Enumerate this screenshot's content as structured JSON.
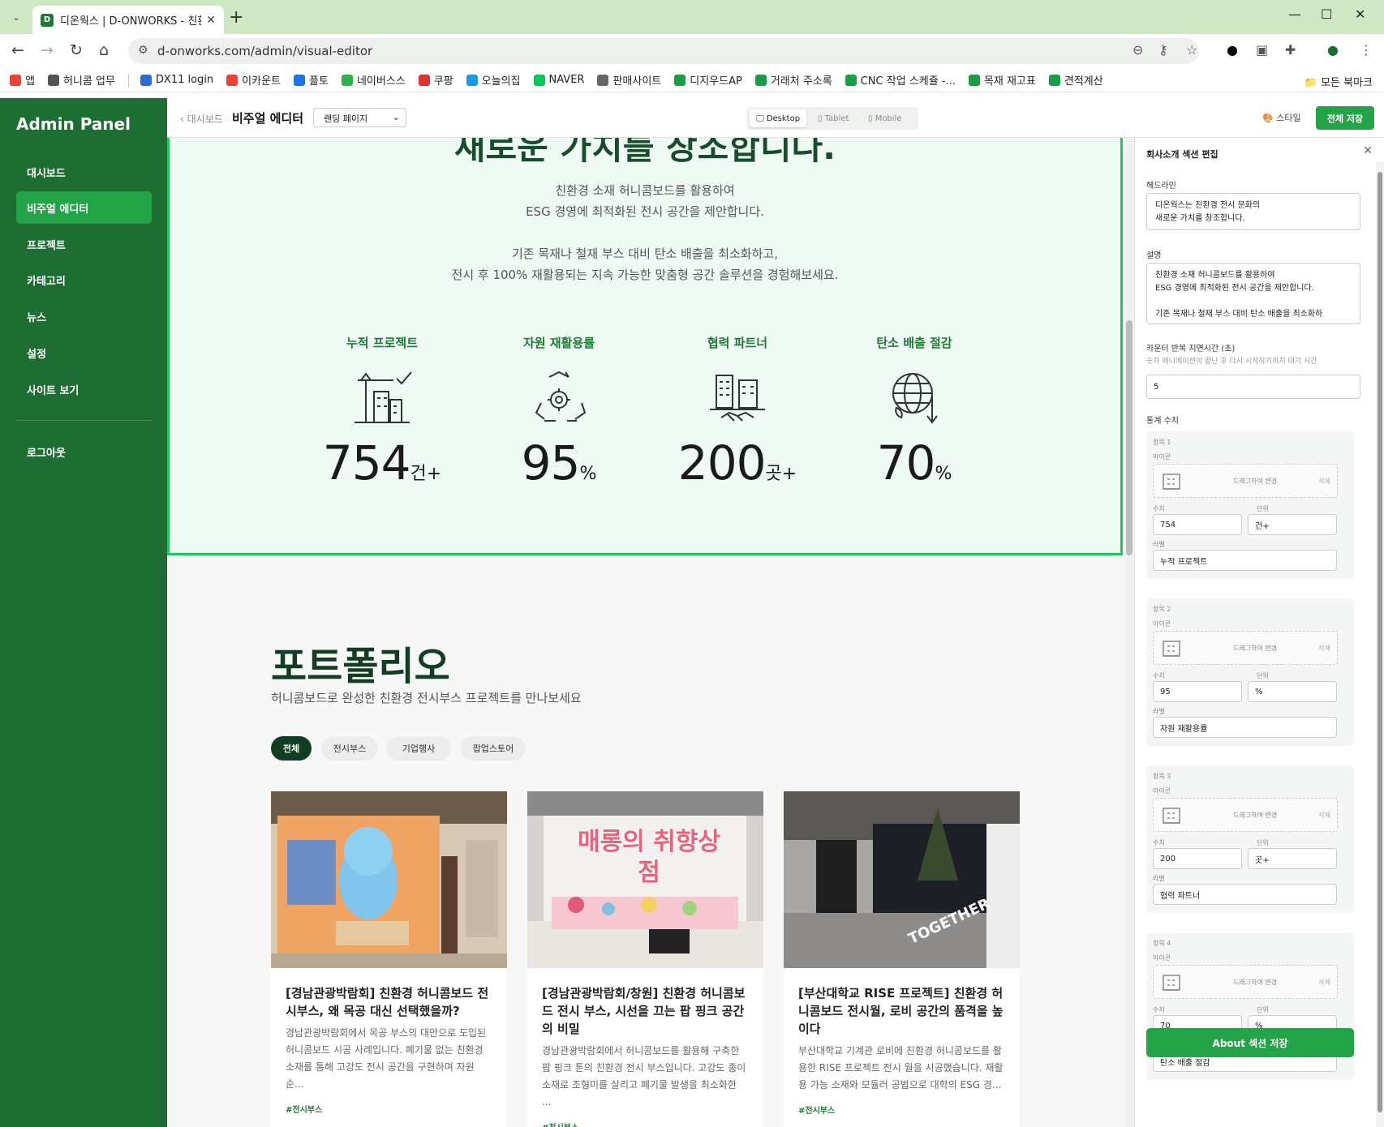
{
  "browser": {
    "tab_title": "디온웍스 | D-ONWORKS - 친환",
    "url": "d-onworks.com/admin/visual-editor",
    "bookmarks": [
      "앱",
      "허니콤 업무",
      "DX11 login",
      "이카운트",
      "플토",
      "네이버스스",
      "쿠팡",
      "오늘의집",
      "NAVER",
      "판매사이트",
      "디지우드AP",
      "거래처 주소록",
      "CNC 작업 스케쥴 -...",
      "목재 재고표",
      "견적계산"
    ],
    "all_bookmarks": "모든 북마크"
  },
  "sidebar": {
    "title": "Admin Panel",
    "items": [
      {
        "label": "대시보드"
      },
      {
        "label": "비주얼 에디터"
      },
      {
        "label": "프로젝트"
      },
      {
        "label": "카테고리"
      },
      {
        "label": "뉴스"
      },
      {
        "label": "설정"
      },
      {
        "label": "사이트 보기"
      }
    ],
    "logout": "로그아웃"
  },
  "topbar": {
    "breadcrumb": "‹ 대시보드",
    "title": "비주얼 에디터",
    "page_select": "랜딩 페이지",
    "devices": [
      "Desktop",
      "Tablet",
      "Mobile"
    ],
    "style_label": "스타일",
    "save_all": "전체 저장"
  },
  "about": {
    "headline_visible": "새로운 가치를 창조합니다.",
    "desc_lines": [
      "친환경 소재 허니콤보드를 활용하여",
      "ESG 경영에 최적화된 전시 공간을 제안합니다.",
      "기존 목재나 철재 부스 대비 탄소 배출을 최소화하고,",
      "전시 후 100% 재활용되는 지속 가능한 맞춤형 공간 솔루션을 경험해보세요."
    ],
    "stats": [
      {
        "label": "누적 프로젝트",
        "value": "754",
        "unit": "건+",
        "icon": "building-crane-icon"
      },
      {
        "label": "자원 재활용률",
        "value": "95",
        "unit": "%",
        "icon": "recycle-gear-icon"
      },
      {
        "label": "협력 파트너",
        "value": "200",
        "unit": "곳+",
        "icon": "handshake-buildings-icon"
      },
      {
        "label": "탄소 배출 절감",
        "value": "70",
        "unit": "%",
        "icon": "globe-leaf-icon"
      }
    ]
  },
  "portfolio": {
    "title": "포트폴리오",
    "subtitle": "허니콤보드로 완성한 친환경 전시부스 프로젝트를 만나보세요",
    "filters": [
      "전체",
      "전시부스",
      "기업행사",
      "팝업스토어"
    ],
    "cards": [
      {
        "title": "[경남관광박람회] 친환경 허니콤보드 전시부스, 왜 목공 대신 선택했을까?",
        "desc": "경남관광박람회에서 목공 부스의 대안으로 도입된 허니콤보드 시공 사례입니다. 폐기물 없는 친환경 소재를 통해 고강도 전시 공간을 구현하며 자원순...",
        "tag": "#전시부스"
      },
      {
        "title": "[경남관광박람회/창원] 친환경 허니콤보드 전시 부스, 시선을 끄는 팝 핑크 공간의 비밀",
        "desc": "경남관광박람회에서 허니콤보드를 활용해 구축한 팝 핑크 톤의 친환경 전시 부스입니다. 고강도 종이 소재로 조형미를 살리고 폐기물 발생을 최소화한 ...",
        "tag": "#전시부스"
      },
      {
        "title": "[부산대학교 RISE 프로젝트] 친환경 허니콤보드 전시월, 로비 공간의 품격을 높이다",
        "desc": "부산대학교 기계관 로비에 친환경 허니콤보드를 활용한 RISE 프로젝트 전시 월을 시공했습니다. 재활용 가능 소재와 모듈러 공법으로 대학의 ESG 경...",
        "tag": "#전시부스"
      }
    ],
    "card_image_texts": [
      "매롱의 취향상점",
      "TOGETHER"
    ]
  },
  "panel": {
    "title": "회사소개 섹션 편집",
    "headline_label": "헤드라인",
    "headline_value": [
      "디온웍스는 친환경 전시 문화의",
      "새로운 가치를 창조합니다."
    ],
    "desc_label": "설명",
    "desc_value": [
      "친환경 소재 허니콤보드를 활용하여",
      "ESG 경영에 최적화된 전시 공간을 제안합니다.",
      "",
      "기존 목재나 철재 부스 대비 탄소 배출을 최소화하"
    ],
    "delay_label": "카운터 반복 지연시간 (초)",
    "delay_hint": "숫자 애니메이션이 끝난 후 다시 시작하기까지 대기 시간",
    "delay_value": "5",
    "stats_label": "통계 수치",
    "item_prefix": [
      "항목 1",
      "항목 2",
      "항목 3",
      "항목 4"
    ],
    "icon_label": "아이콘",
    "drag_text": "드래그하여 변경",
    "delete_text": "삭제",
    "value_label": "수치",
    "unit_label": "단위",
    "label_label": "라벨",
    "save_section": "About 섹션 저장"
  }
}
